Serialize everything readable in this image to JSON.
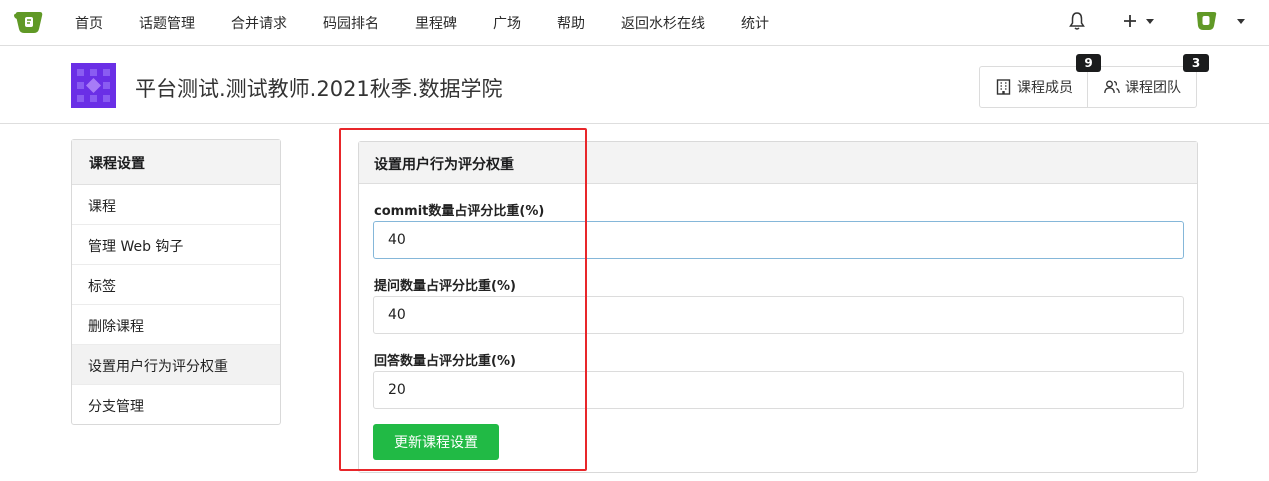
{
  "colors": {
    "accent_green": "#21ba45",
    "brand_green": "#609926",
    "repo_avatar": "#6a2fe6",
    "highlight_red": "#e8262a"
  },
  "nav": {
    "items": [
      "首页",
      "话题管理",
      "合并请求",
      "码园排名",
      "里程碑",
      "广场",
      "帮助",
      "返回水杉在线",
      "统计"
    ],
    "icons": [
      "logo-icon",
      "bell-icon",
      "plus-icon",
      "user-avatar-icon"
    ]
  },
  "header": {
    "title": "平台测试.测试教师.2021秋季.数据学院",
    "members_label": "课程成员",
    "members_count": "9",
    "team_label": "课程团队",
    "team_count": "3"
  },
  "sidebar": {
    "title": "课程设置",
    "items": [
      "课程",
      "管理 Web 钩子",
      "标签",
      "删除课程",
      "设置用户行为评分权重",
      "分支管理"
    ],
    "active_index": 4
  },
  "panel": {
    "title": "设置用户行为评分权重",
    "fields": [
      {
        "label": "commit数量占评分比重(%)",
        "value": "40"
      },
      {
        "label": "提问数量占评分比重(%)",
        "value": "40"
      },
      {
        "label": "回答数量占评分比重(%)",
        "value": "20"
      }
    ],
    "submit_label": "更新课程设置"
  }
}
